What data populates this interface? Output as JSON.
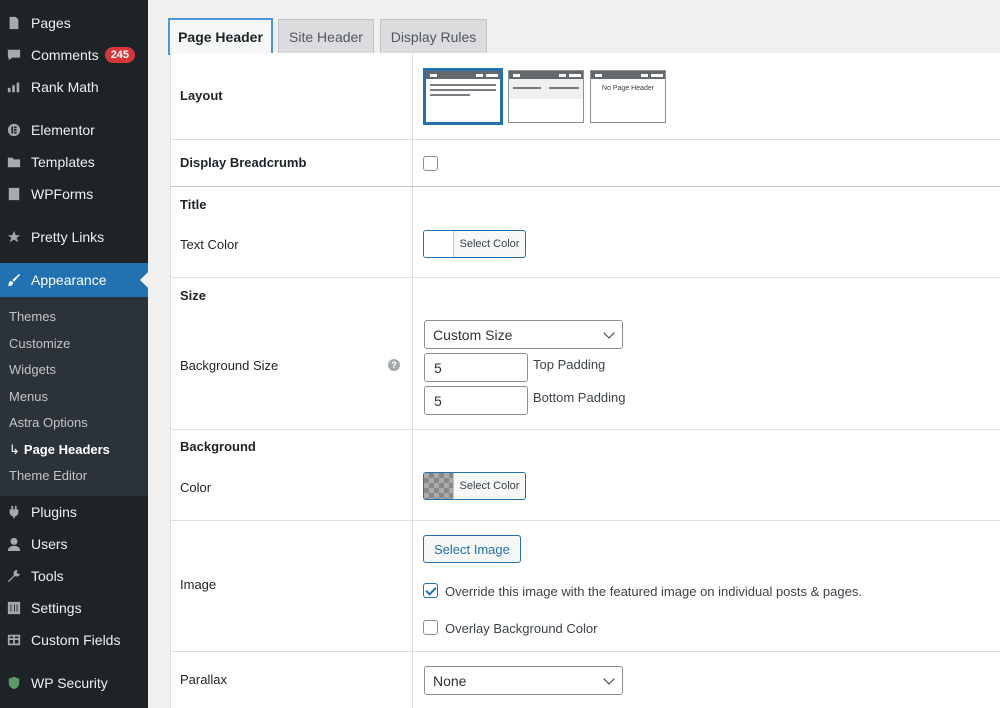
{
  "sidebar": {
    "items": [
      {
        "label": "Pages",
        "icon": "pages-icon"
      },
      {
        "label": "Comments",
        "badge": "245",
        "icon": "comments-icon"
      },
      {
        "label": "Rank Math",
        "icon": "rank-math-icon"
      },
      {
        "label": "Elementor",
        "icon": "elementor-icon"
      },
      {
        "label": "Templates",
        "icon": "folder-icon"
      },
      {
        "label": "WPForms",
        "icon": "wpforms-icon"
      },
      {
        "label": "Pretty Links",
        "icon": "star-icon"
      },
      {
        "label": "Appearance",
        "icon": "brush-icon"
      },
      {
        "label": "Plugins",
        "icon": "plugin-icon"
      },
      {
        "label": "Users",
        "icon": "user-icon"
      },
      {
        "label": "Tools",
        "icon": "wrench-icon"
      },
      {
        "label": "Settings",
        "icon": "settings-icon"
      },
      {
        "label": "Custom Fields",
        "icon": "grid-icon"
      },
      {
        "label": "WP Security",
        "icon": "shield-icon"
      }
    ],
    "submenu": [
      "Themes",
      "Customize",
      "Widgets",
      "Menus",
      "Astra Options",
      "Page Headers",
      "Theme Editor"
    ],
    "submenu_arrow": "↳"
  },
  "tabs": [
    "Page Header",
    "Site Header",
    "Display Rules"
  ],
  "layout": {
    "label": "Layout",
    "no_header_text": "No Page Header"
  },
  "breadcrumb": {
    "label": "Display Breadcrumb",
    "checked": false
  },
  "title": {
    "heading": "Title",
    "text_color_label": "Text Color",
    "select_color": "Select Color"
  },
  "size": {
    "heading": "Size",
    "bg_size_label": "Background Size",
    "help": "?",
    "select_value": "Custom Size",
    "top_padding_value": "5",
    "top_padding_label": "Top Padding",
    "bottom_padding_value": "5",
    "bottom_padding_label": "Bottom Padding"
  },
  "background": {
    "heading": "Background",
    "color_label": "Color",
    "select_color": "Select Color",
    "image_label": "Image",
    "select_image": "Select Image",
    "override_label": "Override this image with the featured image on individual posts & pages.",
    "override_checked": true,
    "overlay_label": "Overlay Background Color",
    "overlay_checked": false
  },
  "parallax": {
    "label": "Parallax",
    "value": "None"
  },
  "colors": {
    "accent": "#2271b1",
    "sidebar_bg": "#1d2327",
    "badge": "#d63638"
  }
}
